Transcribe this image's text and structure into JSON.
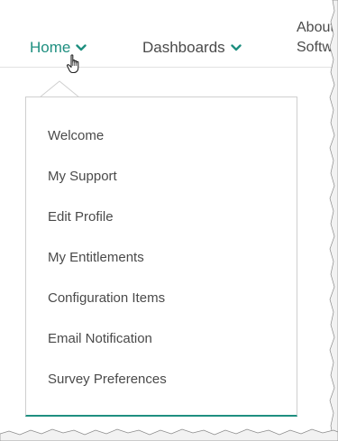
{
  "nav": {
    "home_label": "Home",
    "dashboards_label": "Dashboards",
    "about_line1": "About",
    "about_line2": "Software"
  },
  "menu": {
    "items": [
      {
        "label": "Welcome"
      },
      {
        "label": "My Support"
      },
      {
        "label": "Edit Profile"
      },
      {
        "label": "My Entitlements"
      },
      {
        "label": "Configuration Items"
      },
      {
        "label": "Email Notification"
      },
      {
        "label": "Survey Preferences"
      }
    ]
  },
  "colors": {
    "accent": "#1f8f80",
    "text": "#4a4a4a",
    "border": "#cfcfcf"
  },
  "icons": {
    "chevron": "chevron-down-icon",
    "cursor": "hand-pointer-icon"
  }
}
